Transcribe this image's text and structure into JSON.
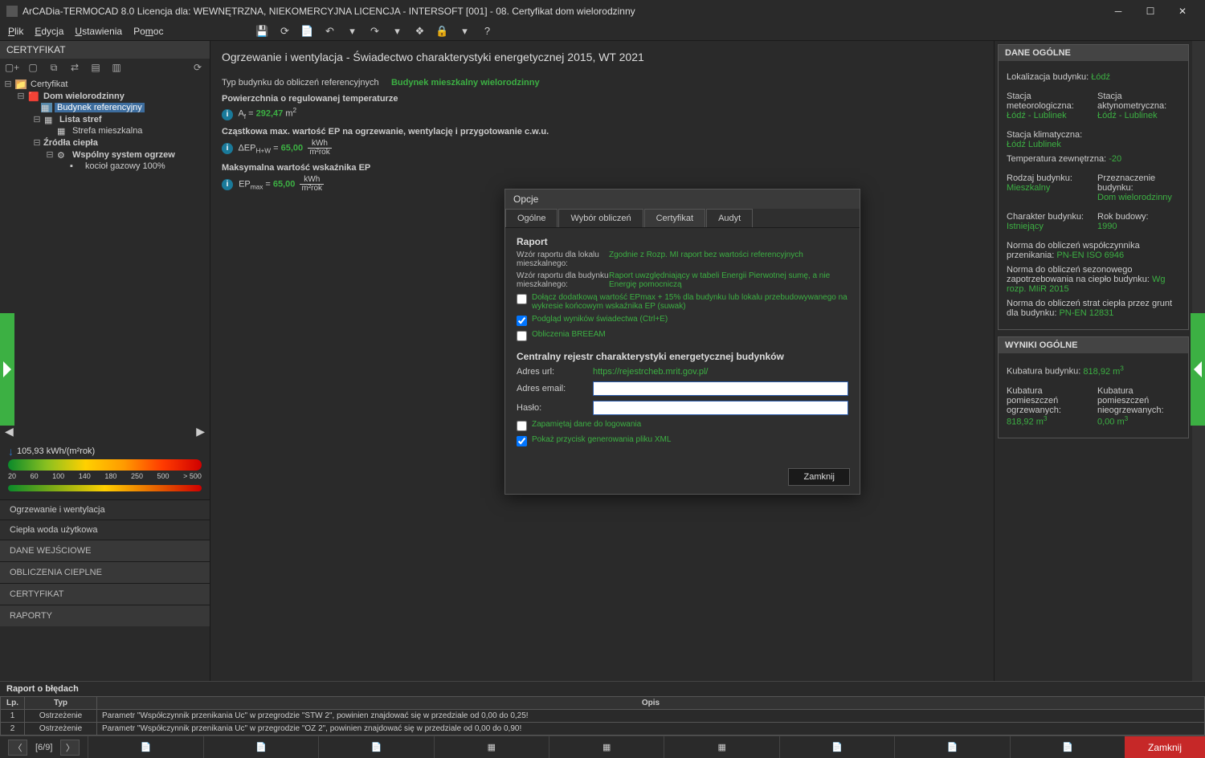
{
  "window": {
    "title": "ArCADia-TERMOCAD 8.0 Licencja dla: WEWNĘTRZNA, NIEKOMERCYJNA LICENCJA - INTERSOFT [001] - 08. Certyfikat dom wielorodzinny"
  },
  "menu": {
    "file": "Plik",
    "edit": "Edycja",
    "settings": "Ustawienia",
    "help": "Pomoc"
  },
  "left": {
    "title": "CERTYFIKAT",
    "tree": {
      "root": "Certyfikat",
      "house": "Dom wielorodzinny",
      "refbld": "Budynek referencyjny",
      "zones": "Lista stref",
      "zone1": "Strefa mieszkalna",
      "heat": "Źródła ciepła",
      "sys": "Wspólny system ogrzew",
      "boiler": "kocioł gazowy 100%"
    },
    "scale": {
      "value": "105,93 kWh/(m²rok)",
      "t1": "20",
      "t2": "60",
      "t3": "100",
      "t4": "140",
      "t5": "180",
      "t6": "250",
      "t7": "500",
      "t8": "> 500"
    },
    "nav": {
      "a": "Ogrzewanie i wentylacja",
      "b": "Ciepła woda użytkowa",
      "c": "DANE WEJŚCIOWE",
      "d": "OBLICZENIA CIEPLNE",
      "e": "CERTYFIKAT",
      "f": "RAPORTY"
    }
  },
  "center": {
    "heading": "Ogrzewanie i wentylacja - Świadectwo charakterystyki energetycznej 2015, WT 2021",
    "row1": {
      "label": "Typ budynku do obliczeń referencyjnych",
      "value": "Budynek mieszkalny wielorodzinny"
    },
    "row2": {
      "label": "Powierzchnia o regulowanej temperaturze",
      "sym": "A",
      "sub": "f",
      "eq": " = ",
      "val": "292,47",
      "unit": " m"
    },
    "row3": {
      "label": "Cząstkowa max. wartość EP na ogrzewanie, wentylację i przygotowanie c.w.u.",
      "sym": "ΔEP",
      "sub": "H+W",
      "eq": " = ",
      "val": "65,00",
      "u1": "kWh",
      "u2": "m²rok"
    },
    "row4": {
      "label": "Maksymalna wartość wskaźnika EP",
      "sym": "EP",
      "sub": "max",
      "eq": " = ",
      "val": "65,00",
      "u1": "kWh",
      "u2": "m²rok"
    }
  },
  "dialog": {
    "title": "Opcje",
    "tabs": {
      "a": "Ogólne",
      "b": "Wybór obliczeń",
      "c": "Certyfikat",
      "d": "Audyt"
    },
    "section1": "Raport",
    "r1l": "Wzór raportu dla lokalu mieszkalnego:",
    "r1v": "Zgodnie z Rozp. MI raport bez wartości referencyjnych",
    "r2l": "Wzór raportu dla budynku mieszkalnego:",
    "r2v": "Raport uwzględniający w tabeli Energii Pierwotnej sumę, a nie Energię pomocniczą",
    "chk1": "Dołącz dodatkową wartość EPmax + 15% dla budynku lub lokalu przebudowywanego na wykresie końcowym wskaźnika EP (suwak)",
    "chk2": "Podgląd wyników świadectwa (Ctrl+E)",
    "chk3": "Obliczenia BREEAM",
    "section2": "Centralny rejestr charakterystyki energetycznej budynków",
    "url_l": "Adres url:",
    "url_v": "https://rejestrcheb.mrit.gov.pl/",
    "email_l": "Adres email:",
    "pass_l": "Hasło:",
    "chk4": "Zapamiętaj dane do logowania",
    "chk5": "Pokaż przycisk generowania pliku XML",
    "close": "Zamknij"
  },
  "right": {
    "p1": {
      "title": "DANE OGÓLNE",
      "loc_l": "Lokalizacja budynku:",
      "loc_v": "Łódź",
      "meteo_l": "Stacja meteorologiczna:",
      "meteo_v": "Łódź - Lublinek",
      "akt_l": "Stacja aktynometryczna:",
      "akt_v": "Łódź - Lublinek",
      "klim_l": "Stacja klimatyczna:",
      "klim_v": "Łódź Lublinek",
      "temp_l": "Temperatura zewnętrzna:",
      "temp_v": "-20",
      "rodz_l": "Rodzaj budynku:",
      "rodz_v": "Mieszkalny",
      "przez_l": "Przeznaczenie budynku:",
      "przez_v": "Dom wielorodzinny",
      "char_l": "Charakter budynku:",
      "char_v": "Istniejący",
      "rok_l": "Rok budowy:",
      "rok_v": "1990",
      "norm1_l": "Norma do obliczeń współczynnika przenikania:",
      "norm1_v": "PN-EN ISO 6946",
      "norm2_l": "Norma do obliczeń sezonowego zapotrzebowania na ciepło budynku:",
      "norm2_v": "Wg rozp. MIiR 2015",
      "norm3_l": "Norma do obliczeń strat ciepła przez grunt dla budynku:",
      "norm3_v": "PN-EN 12831"
    },
    "p2": {
      "title": "WYNIKI OGÓLNE",
      "kub_l": "Kubatura budynku:",
      "kub_v": "818,92 m",
      "ko_l": "Kubatura pomieszczeń ogrzewanych:",
      "ko_v": "818,92 m",
      "kn_l": "Kubatura pomieszczeń nieogrzewanych:",
      "kn_v": "0,00 m"
    }
  },
  "errors": {
    "title": "Raport o błędach",
    "h1": "Lp.",
    "h2": "Typ",
    "h3": "Opis",
    "r1n": "1",
    "r1t": "Ostrzeżenie",
    "r1d": "Parametr \"Współczynnik przenikania Uc\" w przegrodzie \"STW 2\", powinien znajdować się w przedziale od 0,00 do 0,25!",
    "r2n": "2",
    "r2t": "Ostrzeżenie",
    "r2d": "Parametr \"Współczynnik przenikania Uc\" w przegrodzie \"OZ 2\", powinien znajdować się w przedziale od 0,00 do 0,90!"
  },
  "taskbar": {
    "page": "[6/9]",
    "close": "Zamknij"
  }
}
